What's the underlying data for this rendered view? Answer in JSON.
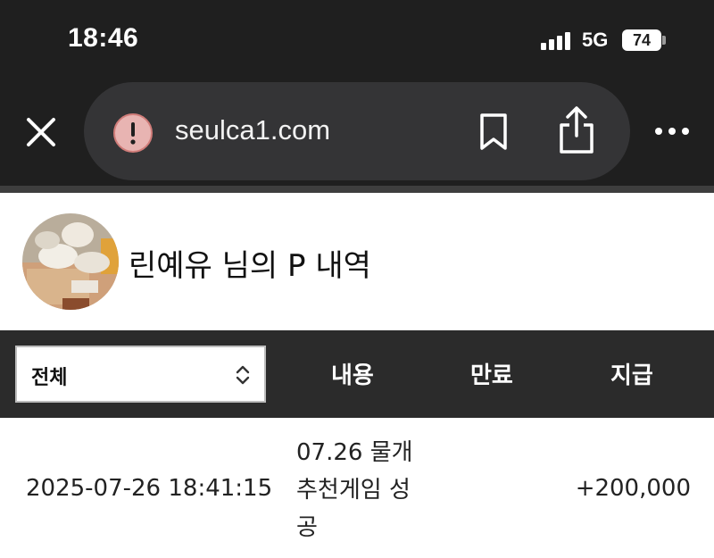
{
  "status_bar": {
    "time": "18:46",
    "network": "5G",
    "battery": "74"
  },
  "browser": {
    "url": "seulca1.com"
  },
  "profile": {
    "title": "린예유 님의 P 내역"
  },
  "table": {
    "filter_selected": "전체",
    "headers": {
      "content": "내용",
      "expiry": "만료",
      "payment": "지급"
    },
    "rows": [
      {
        "date": "2025-07-26 18:41:15",
        "description": "07.26 물개 추천게임 성공",
        "expiry": "",
        "amount": "+200,000"
      }
    ]
  },
  "colors": {
    "chrome_bg": "#1f1f1f",
    "urlbar_bg": "#343436",
    "table_header_bg": "#2b2b2b",
    "alert_icon": "#e8b4b2"
  }
}
